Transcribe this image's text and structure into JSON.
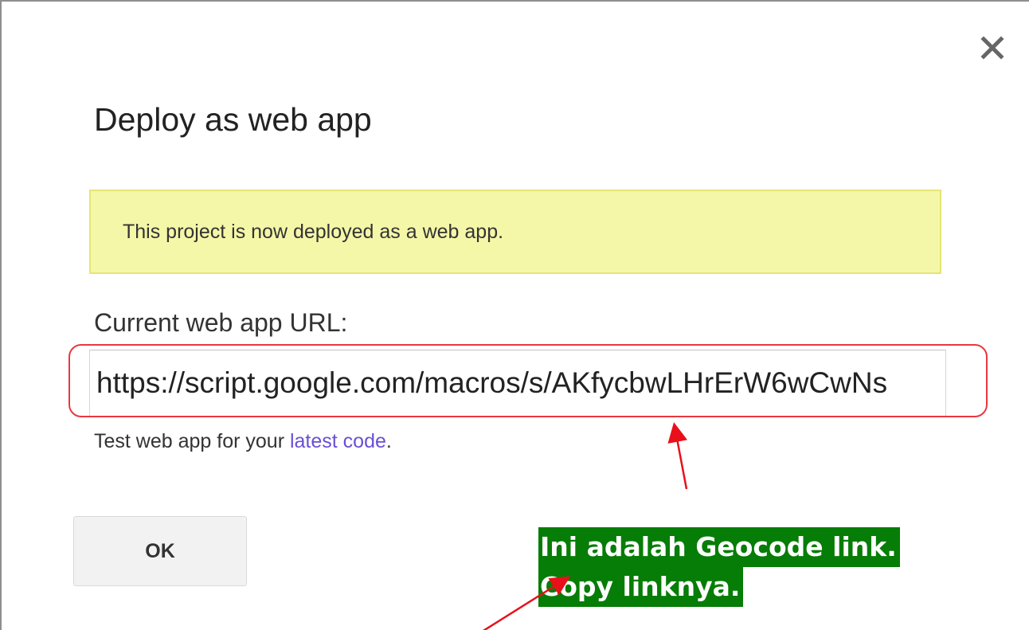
{
  "dialog": {
    "title": "Deploy as web app",
    "close_icon": "close-icon",
    "notice": "This project is now deployed as a web app.",
    "url_label": "Current web app URL:",
    "url_value": "https://script.google.com/macros/s/AKfycbwLHrErW6wCwNs",
    "test_text": "Test web app for your ",
    "test_link": "latest code",
    "test_suffix": ".",
    "ok_label": "OK"
  },
  "annotation": {
    "line1": "Ini adalah Geocode link.",
    "line2": "Copy linknya.",
    "highlight_color": "#e8383f",
    "callout_bg": "#067d06"
  },
  "colors": {
    "notice_bg": "#f5f7a8",
    "notice_border": "#e7e476",
    "link": "#6a4fd6"
  }
}
